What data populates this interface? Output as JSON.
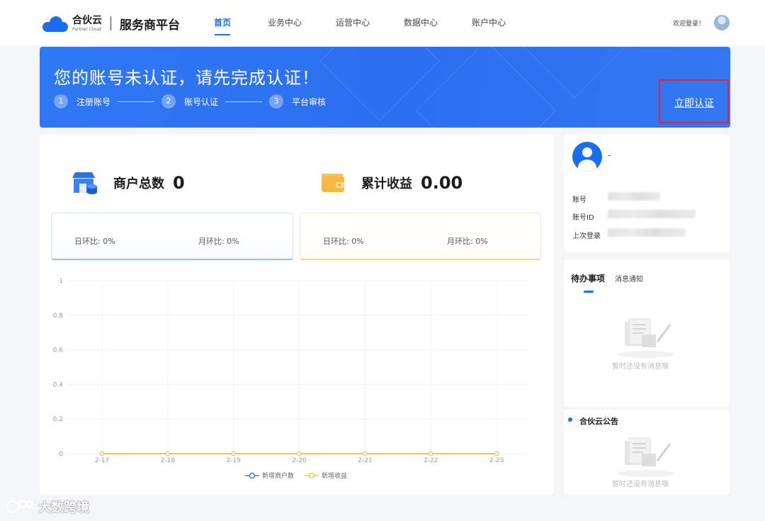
{
  "header": {
    "logo_cn": "合伙云",
    "logo_en": "Partner Cloud",
    "platform": "服务商平台",
    "nav": [
      {
        "label": "首页",
        "active": true
      },
      {
        "label": "业务中心",
        "active": false
      },
      {
        "label": "运营中心",
        "active": false
      },
      {
        "label": "数据中心",
        "active": false
      },
      {
        "label": "账户中心",
        "active": false
      }
    ],
    "welcome": "欢迎登录！"
  },
  "banner": {
    "title": "您的账号未认证，请先完成认证！",
    "steps": [
      {
        "num": "1",
        "label": "注册账号"
      },
      {
        "num": "2",
        "label": "账号认证"
      },
      {
        "num": "3",
        "label": "平台审核"
      }
    ],
    "action": "立即认证"
  },
  "stats": {
    "merchants": {
      "label": "商户总数",
      "value": "0",
      "day_label": "日环比:",
      "day_value": "0%",
      "month_label": "月环比:",
      "month_value": "0%"
    },
    "income": {
      "label": "累计收益",
      "value": "0.00",
      "day_label": "日环比:",
      "day_value": "0%",
      "month_label": "月环比:",
      "month_value": "0%"
    }
  },
  "chart_data": {
    "type": "line",
    "x": [
      "2-17",
      "2-18",
      "2-19",
      "2-20",
      "2-21",
      "2-22",
      "2-23"
    ],
    "yticks": [
      "0",
      "0.2",
      "0.4",
      "0.6",
      "0.8",
      "1"
    ],
    "ylim": [
      0,
      1
    ],
    "series": [
      {
        "name": "新增商户数",
        "color": "#3a7bf0",
        "values": [
          0,
          0,
          0,
          0,
          0,
          0,
          0
        ]
      },
      {
        "name": "新增收益",
        "color": "#f2c94c",
        "values": [
          0,
          0,
          0,
          0,
          0,
          0,
          0
        ]
      }
    ],
    "legend": "bottom-center",
    "grid": true
  },
  "profile": {
    "name": "-",
    "rows": [
      {
        "label": "账号"
      },
      {
        "label": "账号ID"
      },
      {
        "label": "上次登录"
      }
    ]
  },
  "todo": {
    "tab_active": "待办事项",
    "tab_other": "消息通知",
    "empty": "暂时还没有消息哦"
  },
  "notice": {
    "title": "合伙云公告",
    "empty": "暂时还没有消息哦"
  },
  "watermark": "大数跨境",
  "colors": {
    "primary": "#1a6cf0",
    "alert_border": "#e4262a",
    "income": "#f2c94c"
  }
}
